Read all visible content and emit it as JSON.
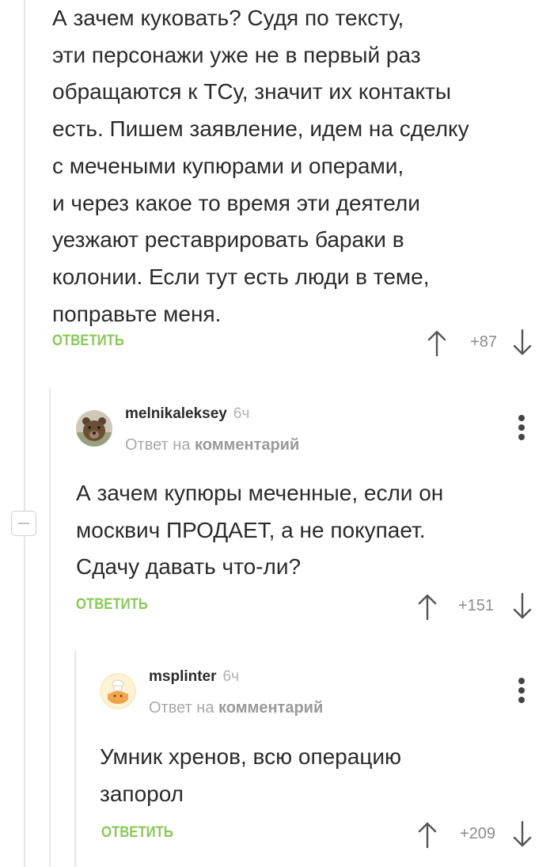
{
  "comments": [
    {
      "text_lines": [
        "А зачем куковать? Судя по тексту,",
        "эти персонажи уже не в первый раз",
        "обращаются к ТСу, значит их контакты",
        "есть. Пишем заявление, идем на сделку",
        "с мечеными купюрами и операми,",
        "и через какое то время эти деятели",
        "уезжают реставрировать бараки в",
        "колонии. Если тут есть люди в теме,",
        "поправьте меня."
      ],
      "reply_label": "ОТВЕТИТЬ",
      "rating": "+87"
    },
    {
      "author": "melnikaleksey",
      "time": "6ч",
      "reply_to_prefix": "Ответ на",
      "reply_to_link": "комментарий",
      "text_lines": [
        "А зачем купюры меченные, если он",
        "москвич ПРОДАЕТ, а не покупает.",
        "Сдачу давать что-ли?"
      ],
      "reply_label": "ОТВЕТИТЬ",
      "rating": "+151"
    },
    {
      "author": "msplinter",
      "time": "6ч",
      "reply_to_prefix": "Ответ на",
      "reply_to_link": "комментарий",
      "text_lines": [
        "Умник хренов, всю операцию",
        "запорол"
      ],
      "reply_label": "ОТВЕТИТЬ",
      "rating": "+209"
    }
  ],
  "colors": {
    "reply_green": "#8ac858",
    "thread_line": "#e6e6e6",
    "muted": "#a8a8a8"
  },
  "icons": {
    "vote_up": "arrow-up-icon",
    "vote_down": "arrow-down-icon",
    "menu": "kebab-menu-icon",
    "collapse": "minus-icon"
  }
}
